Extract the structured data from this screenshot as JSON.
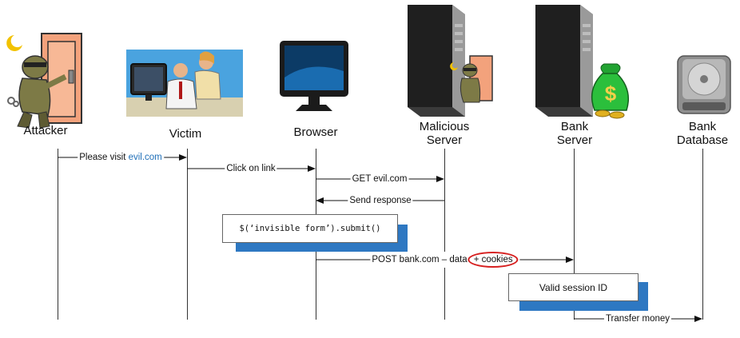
{
  "actors": {
    "attacker": "Attacker",
    "victim": "Victim",
    "browser": "Browser",
    "malicious_server": [
      "Malicious",
      "Server"
    ],
    "bank_server": [
      "Bank",
      "Server"
    ],
    "bank_database": [
      "Bank",
      "Database"
    ]
  },
  "messages": {
    "m1_prefix": "Please visit ",
    "m1_link": "evil.com",
    "m2": "Click on link",
    "m3": "GET evil.com",
    "m4": "Send response",
    "m5_main": "POST bank.com – data",
    "m5_highlight": "+ cookies",
    "m6": "Transfer money"
  },
  "boxes": {
    "script": "$(‘invisible form’).submit()",
    "session": "Valid session ID"
  },
  "colors": {
    "link": "#1f6fb8",
    "box_shadow": "#2e78c2",
    "highlight_ring": "#d62020"
  },
  "icons": {
    "attacker": "burglar-at-door-icon",
    "victim": "office-workers-at-computer-icon",
    "browser": "monitor-icon",
    "malicious_server": "server-tower-with-burglar-icon",
    "bank_server": "server-tower-with-money-bag-icon",
    "bank_database": "hard-drive-icon"
  }
}
